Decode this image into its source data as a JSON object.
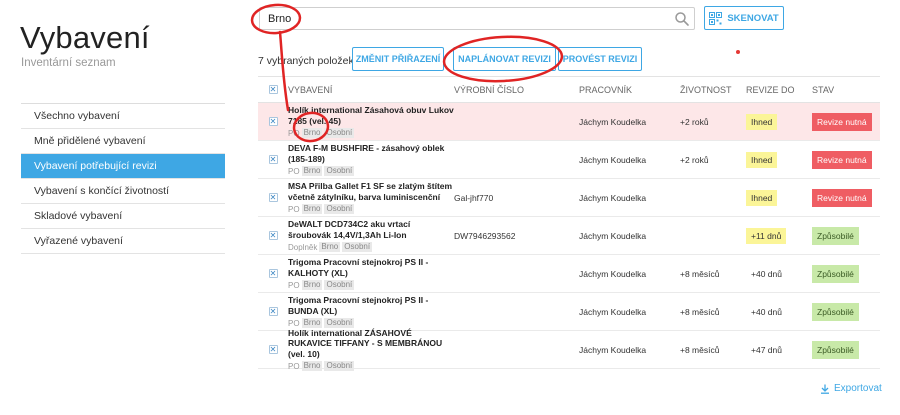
{
  "page": {
    "title": "Vybavení",
    "subtitle": "Inventární seznam"
  },
  "sidebar": {
    "items": [
      {
        "label": "Všechno vybavení",
        "active": false
      },
      {
        "label": "Mně přidělené vybavení",
        "active": false
      },
      {
        "label": "Vybavení potřebující revizi",
        "active": true
      },
      {
        "label": "Vybavení s končící životností",
        "active": false
      },
      {
        "label": "Skladové vybavení",
        "active": false
      },
      {
        "label": "Vyřazené vybavení",
        "active": false
      }
    ]
  },
  "search": {
    "value": "Brno",
    "icon": "search-icon"
  },
  "scan": {
    "label": "SKENOVAT",
    "icon": "qr-code-icon"
  },
  "toolbar": {
    "selected_text": "7 vybraných položek:",
    "change_label": "ZMĚNIT PŘIŘAZENÍ",
    "plan_label": "NAPLÁNOVAT REVIZI",
    "perform_label": "PROVÉST REVIZI"
  },
  "table": {
    "columns": [
      "VYBAVENÍ",
      "VÝROBNÍ ČÍSLO",
      "PRACOVNÍK",
      "ŽIVOTNOST",
      "REVIZE DO",
      "STAV"
    ],
    "rows": [
      {
        "name": "Holík international Zásahová obuv Lukov 7185 (vel. 45)",
        "category": "PO",
        "tags": [
          "Brno",
          "Osobní"
        ],
        "serial": "",
        "worker": "Jáchym Koudelka",
        "lifetime": "+2 roků",
        "revision": "Ihned",
        "state": "Revize nutná"
      },
      {
        "name": "DEVA F-M BUSHFIRE - zásahový oblek (185-189)",
        "category": "PO",
        "tags": [
          "Brno",
          "Osobní"
        ],
        "serial": "",
        "worker": "Jáchym Koudelka",
        "lifetime": "+2 roků",
        "revision": "Ihned",
        "state": "Revize nutná"
      },
      {
        "name": "MSA Přilba Gallet F1 SF se zlatým štítem včetně zátylníku, barva luminiscenční",
        "category": "PO",
        "tags": [
          "Brno",
          "Osobní"
        ],
        "serial": "Gal-jhf770",
        "worker": "Jáchym Koudelka",
        "lifetime": "",
        "revision": "Ihned",
        "state": "Revize nutná"
      },
      {
        "name": "DeWALT DCD734C2 aku vrtací šroubovák 14,4V/1,3Ah Li-Ion",
        "category": "Doplněk",
        "tags": [
          "Brno",
          "Osobní"
        ],
        "serial": "DW7946293562",
        "worker": "Jáchym Koudelka",
        "lifetime": "",
        "revision": "+11 dnů",
        "state": "Způsobilé"
      },
      {
        "name": "Trigoma Pracovní stejnokroj PS II - KALHOTY (XL)",
        "category": "PO",
        "tags": [
          "Brno",
          "Osobní"
        ],
        "serial": "",
        "worker": "Jáchym Koudelka",
        "lifetime": "+8 měsíců",
        "revision": "+40 dnů",
        "state": "Způsobilé"
      },
      {
        "name": "Trigoma Pracovní stejnokroj PS II - BUNDA (XL)",
        "category": "PO",
        "tags": [
          "Brno",
          "Osobní"
        ],
        "serial": "",
        "worker": "Jáchym Koudelka",
        "lifetime": "+8 měsíců",
        "revision": "+40 dnů",
        "state": "Způsobilé"
      },
      {
        "name": "Holík international ZÁSAHOVÉ RUKAVICE TIFFANY - S MEMBRÁNOU (vel. 10)",
        "category": "PO",
        "tags": [
          "Brno",
          "Osobní"
        ],
        "serial": "",
        "worker": "Jáchym Koudelka",
        "lifetime": "+8 měsíců",
        "revision": "+47 dnů",
        "state": "Způsobilé"
      }
    ]
  },
  "export": {
    "label": "Exportovat",
    "icon": "download-icon"
  },
  "colors": {
    "accent": "#3ea7e4",
    "danger": "#ef5d63",
    "success_bg": "#c8e9a8",
    "warning_bg": "#fbf598",
    "highlight_row": "#fde7e8",
    "annotation": "#e02424"
  }
}
